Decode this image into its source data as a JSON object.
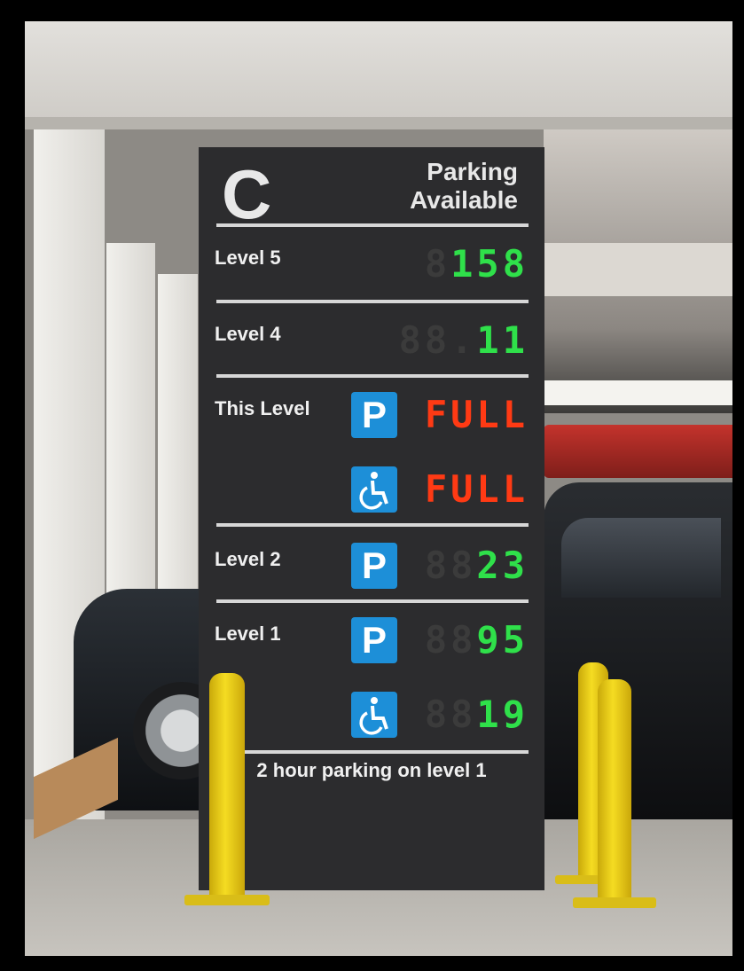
{
  "sign": {
    "letter": "C",
    "header_line1": "Parking",
    "header_line2": "Available",
    "rows": [
      {
        "label": "Level 5",
        "ghost": "8",
        "value": "158",
        "color": "#2fe04a"
      },
      {
        "label": "Level 4",
        "ghost": "88.",
        "value": "11",
        "color": "#2fe04a"
      },
      {
        "label": "This Level",
        "value": "FULL",
        "accessible_value": "FULL",
        "color": "#ff3a14"
      },
      {
        "label": "Level 2",
        "ghost": "88",
        "value": "23",
        "color": "#2fe04a"
      },
      {
        "label": "Level 1",
        "ghost": "88",
        "value": "95",
        "accessible_ghost": "88",
        "accessible_value": "19",
        "color": "#2fe04a"
      }
    ],
    "parking_icon": "P",
    "footer": "2 hour parking on level 1"
  },
  "icons": [
    "parking-icon",
    "wheelchair-icon"
  ]
}
